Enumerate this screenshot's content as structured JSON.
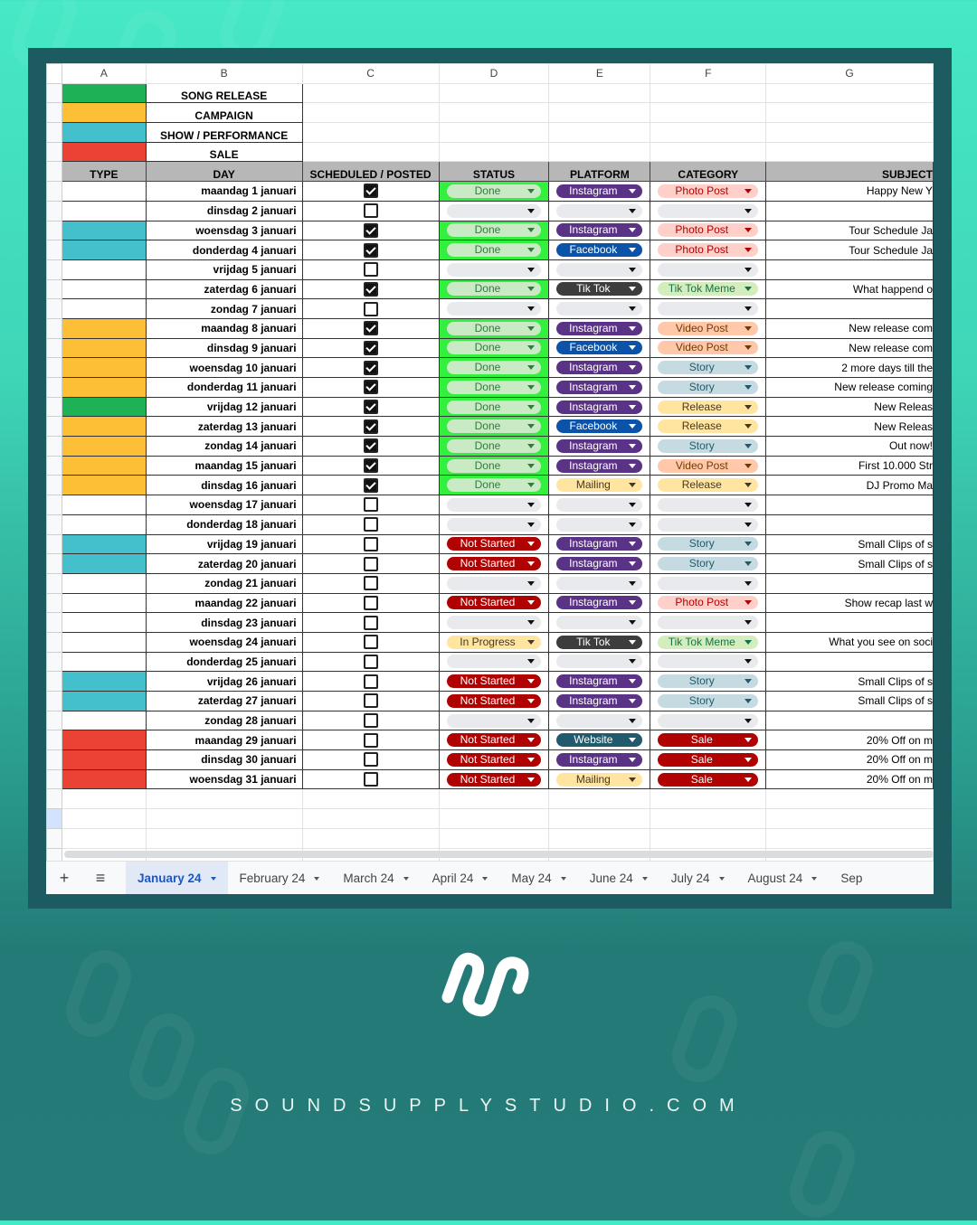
{
  "brand": {
    "website": "SOUNDSUPPLYSTUDIO.COM",
    "logo_icon": "wave-s-logo-icon"
  },
  "columns": [
    "A",
    "B",
    "C",
    "D",
    "E",
    "F",
    "G"
  ],
  "legend": [
    {
      "label": "SONG RELEASE",
      "type": "song"
    },
    {
      "label": "CAMPAIGN",
      "type": "campaign"
    },
    {
      "label": "SHOW / PERFORMANCE",
      "type": "show"
    },
    {
      "label": "SALE",
      "type": "sale"
    }
  ],
  "colors": {
    "song": "#1fb155",
    "campaign": "#fcbf35",
    "show": "#44bfcc",
    "sale": "#ea4335",
    "status_done_bg": "#33ef3e"
  },
  "headers": {
    "type": "TYPE",
    "day": "DAY",
    "scheduled": "SCHEDULED / POSTED",
    "status": "STATUS",
    "platform": "PLATFORM",
    "category": "CATEGORY",
    "subject": "SUBJECT"
  },
  "rows": [
    {
      "type": "",
      "day": "maandag 1 januari",
      "checked": true,
      "status": "Done",
      "platform": "Instagram",
      "category": "Photo Post",
      "subject": "Happy New Y"
    },
    {
      "type": "",
      "day": "dinsdag 2 januari",
      "checked": false,
      "status": "",
      "platform": "",
      "category": "",
      "subject": ""
    },
    {
      "type": "show",
      "day": "woensdag 3 januari",
      "checked": true,
      "status": "Done",
      "platform": "Instagram",
      "category": "Photo Post",
      "subject": "Tour Schedule Ja"
    },
    {
      "type": "show",
      "day": "donderdag 4 januari",
      "checked": true,
      "status": "Done",
      "platform": "Facebook",
      "category": "Photo Post",
      "subject": "Tour Schedule Ja"
    },
    {
      "type": "",
      "day": "vrijdag 5 januari",
      "checked": false,
      "status": "",
      "platform": "",
      "category": "",
      "subject": ""
    },
    {
      "type": "",
      "day": "zaterdag 6 januari",
      "checked": true,
      "status": "Done",
      "platform": "Tik Tok",
      "category": "Tik Tok Meme",
      "subject": "What happend o"
    },
    {
      "type": "",
      "day": "zondag 7 januari",
      "checked": false,
      "status": "",
      "platform": "",
      "category": "",
      "subject": ""
    },
    {
      "type": "campaign",
      "day": "maandag 8 januari",
      "checked": true,
      "status": "Done",
      "platform": "Instagram",
      "category": "Video Post",
      "subject": "New release com"
    },
    {
      "type": "campaign",
      "day": "dinsdag 9 januari",
      "checked": true,
      "status": "Done",
      "platform": "Facebook",
      "category": "Video Post",
      "subject": "New release com"
    },
    {
      "type": "campaign",
      "day": "woensdag 10 januari",
      "checked": true,
      "status": "Done",
      "platform": "Instagram",
      "category": "Story",
      "subject": "2 more days till the"
    },
    {
      "type": "campaign",
      "day": "donderdag 11 januari",
      "checked": true,
      "status": "Done",
      "platform": "Instagram",
      "category": "Story",
      "subject": "New release coming"
    },
    {
      "type": "song",
      "day": "vrijdag 12 januari",
      "checked": true,
      "status": "Done",
      "platform": "Instagram",
      "category": "Release",
      "subject": "New Releas"
    },
    {
      "type": "campaign",
      "day": "zaterdag 13 januari",
      "checked": true,
      "status": "Done",
      "platform": "Facebook",
      "category": "Release",
      "subject": "New Releas"
    },
    {
      "type": "campaign",
      "day": "zondag 14 januari",
      "checked": true,
      "status": "Done",
      "platform": "Instagram",
      "category": "Story",
      "subject": "Out now!"
    },
    {
      "type": "campaign",
      "day": "maandag 15 januari",
      "checked": true,
      "status": "Done",
      "platform": "Instagram",
      "category": "Video Post",
      "subject": "First 10.000 Str"
    },
    {
      "type": "campaign",
      "day": "dinsdag 16 januari",
      "checked": true,
      "status": "Done",
      "platform": "Mailing",
      "category": "Release",
      "subject": "DJ Promo Ma"
    },
    {
      "type": "",
      "day": "woensdag 17 januari",
      "checked": false,
      "status": "",
      "platform": "",
      "category": "",
      "subject": ""
    },
    {
      "type": "",
      "day": "donderdag 18 januari",
      "checked": false,
      "status": "",
      "platform": "",
      "category": "",
      "subject": ""
    },
    {
      "type": "show",
      "day": "vrijdag 19 januari",
      "checked": false,
      "status": "Not Started",
      "platform": "Instagram",
      "category": "Story",
      "subject": "Small Clips of s"
    },
    {
      "type": "show",
      "day": "zaterdag 20 januari",
      "checked": false,
      "status": "Not Started",
      "platform": "Instagram",
      "category": "Story",
      "subject": "Small Clips of s"
    },
    {
      "type": "",
      "day": "zondag 21 januari",
      "checked": false,
      "status": "",
      "platform": "",
      "category": "",
      "subject": ""
    },
    {
      "type": "",
      "day": "maandag 22 januari",
      "checked": false,
      "status": "Not Started",
      "platform": "Instagram",
      "category": "Photo Post",
      "subject": "Show recap last w"
    },
    {
      "type": "",
      "day": "dinsdag 23 januari",
      "checked": false,
      "status": "",
      "platform": "",
      "category": "",
      "subject": ""
    },
    {
      "type": "",
      "day": "woensdag 24 januari",
      "checked": false,
      "status": "In Progress",
      "platform": "Tik Tok",
      "category": "Tik Tok Meme",
      "subject": "What you see on soci"
    },
    {
      "type": "",
      "day": "donderdag 25 januari",
      "checked": false,
      "status": "",
      "platform": "",
      "category": "",
      "subject": ""
    },
    {
      "type": "show",
      "day": "vrijdag 26 januari",
      "checked": false,
      "status": "Not Started",
      "platform": "Instagram",
      "category": "Story",
      "subject": "Small Clips of s"
    },
    {
      "type": "show",
      "day": "zaterdag 27 januari",
      "checked": false,
      "status": "Not Started",
      "platform": "Instagram",
      "category": "Story",
      "subject": "Small Clips of s"
    },
    {
      "type": "",
      "day": "zondag 28 januari",
      "checked": false,
      "status": "",
      "platform": "",
      "category": "",
      "subject": ""
    },
    {
      "type": "sale",
      "day": "maandag 29 januari",
      "checked": false,
      "status": "Not Started",
      "platform": "Website",
      "category": "Sale",
      "subject": "20% Off on m"
    },
    {
      "type": "sale",
      "day": "dinsdag 30 januari",
      "checked": false,
      "status": "Not Started",
      "platform": "Instagram",
      "category": "Sale",
      "subject": "20% Off on m"
    },
    {
      "type": "sale",
      "day": "woensdag 31 januari",
      "checked": false,
      "status": "Not Started",
      "platform": "Mailing",
      "category": "Sale",
      "subject": "20% Off on m"
    }
  ],
  "tabs": {
    "add_icon": "+",
    "menu_icon": "≡",
    "items": [
      {
        "label": "January 24",
        "active": true
      },
      {
        "label": "February 24",
        "active": false
      },
      {
        "label": "March 24",
        "active": false
      },
      {
        "label": "April 24",
        "active": false
      },
      {
        "label": "May 24",
        "active": false
      },
      {
        "label": "June 24",
        "active": false
      },
      {
        "label": "July 24",
        "active": false
      },
      {
        "label": "August 24",
        "active": false
      },
      {
        "label": "Sep",
        "active": false
      }
    ]
  }
}
